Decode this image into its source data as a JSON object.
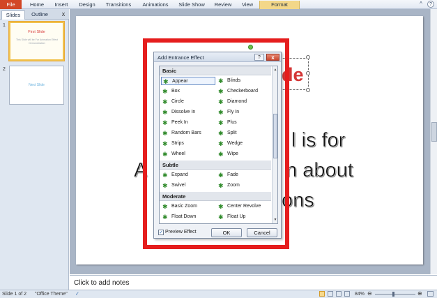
{
  "ribbon": {
    "tabs": [
      "File",
      "Home",
      "Insert",
      "Design",
      "Transitions",
      "Animations",
      "Slide Show",
      "Review",
      "View",
      "Format"
    ],
    "help_icon": "?",
    "minimize_icon": "^"
  },
  "left_panel": {
    "tabs": [
      "Slides",
      "Outline"
    ],
    "close_icon": "x",
    "slides": [
      {
        "number": "1",
        "title": "First Slide",
        "body": "This Slide will be For Animation Effect Demonstration"
      },
      {
        "number": "2",
        "title": "Next Slide",
        "body": ""
      }
    ]
  },
  "slide": {
    "title_fragment": "de",
    "body_lines": [
      "l is for",
      "A",
      "n about",
      "ons"
    ]
  },
  "dialog": {
    "title": "Add Entrance Effect",
    "help_label": "?",
    "close_label": "x",
    "categories": [
      {
        "name": "Basic",
        "effects": [
          "Appear",
          "Blinds",
          "Box",
          "Checkerboard",
          "Circle",
          "Diamond",
          "Dissolve In",
          "Fly In",
          "Peek In",
          "Plus",
          "Random Bars",
          "Split",
          "Strips",
          "Wedge",
          "Wheel",
          "Wipe"
        ]
      },
      {
        "name": "Subtle",
        "effects": [
          "Expand",
          "Fade",
          "Swivel",
          "Zoom"
        ]
      },
      {
        "name": "Moderate",
        "effects": [
          "Basic Zoom",
          "Center Revolve",
          "Float Down",
          "Float Up"
        ]
      }
    ],
    "selected_effect": "Appear",
    "preview_label": "Preview Effect",
    "preview_checked": true,
    "ok_label": "OK",
    "cancel_label": "Cancel"
  },
  "notes": {
    "placeholder": "Click to add notes"
  },
  "status_bar": {
    "slide_info": "Slide 1 of 2",
    "theme": "\"Office Theme\"",
    "zoom": "84%"
  },
  "colors": {
    "file_tab": "#d24726",
    "format_tab": "#f3d789",
    "annotation_frame": "#e51d1d",
    "slide_title": "#d43636"
  }
}
